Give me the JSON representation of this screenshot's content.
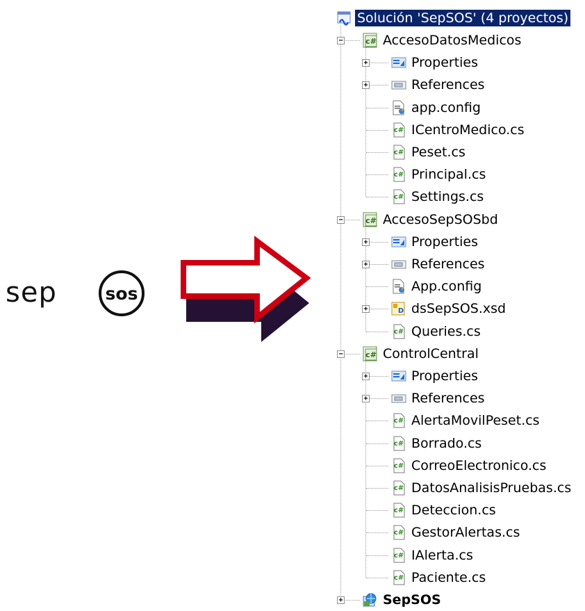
{
  "logo": {
    "prefix": "sep",
    "badge": "sos"
  },
  "arrow": {
    "fill": "#ffffff",
    "stroke": "#cc0012",
    "shadow": "#241133"
  },
  "tree": {
    "root": "Solución 'SepSOS' (4 proyectos)",
    "nodes": [
      {
        "label": "AccesoDatosMedicos",
        "level": 1,
        "icon": "csharp-project-icon",
        "expander": "-"
      },
      {
        "label": "Properties",
        "level": 2,
        "icon": "properties-icon",
        "expander": "+"
      },
      {
        "label": "References",
        "level": 2,
        "icon": "references-icon",
        "expander": "+"
      },
      {
        "label": "app.config",
        "level": 2,
        "icon": "config-file-icon",
        "expander": ""
      },
      {
        "label": "ICentroMedico.cs",
        "level": 2,
        "icon": "csharp-file-icon",
        "expander": ""
      },
      {
        "label": "Peset.cs",
        "level": 2,
        "icon": "csharp-file-icon",
        "expander": ""
      },
      {
        "label": "Principal.cs",
        "level": 2,
        "icon": "csharp-file-icon",
        "expander": ""
      },
      {
        "label": "Settings.cs",
        "level": 2,
        "icon": "csharp-file-icon",
        "expander": ""
      },
      {
        "label": "AccesoSepSOSbd",
        "level": 1,
        "icon": "csharp-project-icon",
        "expander": "-"
      },
      {
        "label": "Properties",
        "level": 2,
        "icon": "properties-icon",
        "expander": "+"
      },
      {
        "label": "References",
        "level": 2,
        "icon": "references-icon",
        "expander": "+"
      },
      {
        "label": "App.config",
        "level": 2,
        "icon": "config-file-icon",
        "expander": ""
      },
      {
        "label": "dsSepSOS.xsd",
        "level": 2,
        "icon": "dataset-icon",
        "expander": "+"
      },
      {
        "label": "Queries.cs",
        "level": 2,
        "icon": "csharp-file-icon",
        "expander": ""
      },
      {
        "label": "ControlCentral",
        "level": 1,
        "icon": "csharp-project-icon",
        "expander": "-"
      },
      {
        "label": "Properties",
        "level": 2,
        "icon": "properties-icon",
        "expander": "+"
      },
      {
        "label": "References",
        "level": 2,
        "icon": "references-icon",
        "expander": "+"
      },
      {
        "label": "AlertaMovilPeset.cs",
        "level": 2,
        "icon": "csharp-file-icon",
        "expander": ""
      },
      {
        "label": "Borrado.cs",
        "level": 2,
        "icon": "csharp-file-icon",
        "expander": ""
      },
      {
        "label": "CorreoElectronico.cs",
        "level": 2,
        "icon": "csharp-file-icon",
        "expander": ""
      },
      {
        "label": "DatosAnalisisPruebas.cs",
        "level": 2,
        "icon": "csharp-file-icon",
        "expander": ""
      },
      {
        "label": "Deteccion.cs",
        "level": 2,
        "icon": "csharp-file-icon",
        "expander": ""
      },
      {
        "label": "GestorAlertas.cs",
        "level": 2,
        "icon": "csharp-file-icon",
        "expander": ""
      },
      {
        "label": "IAlerta.cs",
        "level": 2,
        "icon": "csharp-file-icon",
        "expander": ""
      },
      {
        "label": "Paciente.cs",
        "level": 2,
        "icon": "csharp-file-icon",
        "expander": ""
      },
      {
        "label": "SepSOS",
        "level": 1,
        "icon": "web-project-icon",
        "expander": "+",
        "bold": true
      }
    ]
  }
}
